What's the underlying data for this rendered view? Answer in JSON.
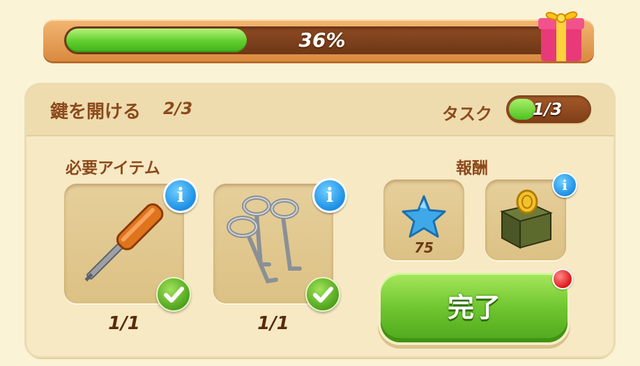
{
  "progress": {
    "percent_label": "36%",
    "fraction": 0.36
  },
  "quest": {
    "title": "鍵を開ける",
    "count": "2/3"
  },
  "task": {
    "label": "タスク",
    "count": "1/3",
    "fraction": 0.333
  },
  "required": {
    "label": "必要アイテム",
    "items": [
      {
        "icon": "screwdriver-icon",
        "count": "1/1"
      },
      {
        "icon": "keys-icon",
        "count": "1/1"
      }
    ]
  },
  "rewards": {
    "label": "報酬",
    "items": [
      {
        "icon": "blue-star-gem-icon",
        "value": "75"
      },
      {
        "icon": "coin-box-icon"
      }
    ]
  },
  "complete_button": {
    "label": "完了"
  },
  "colors": {
    "accent_green": "#5fce2c",
    "brown": "#8c4a1c",
    "info_blue": "#1d8ee6"
  }
}
